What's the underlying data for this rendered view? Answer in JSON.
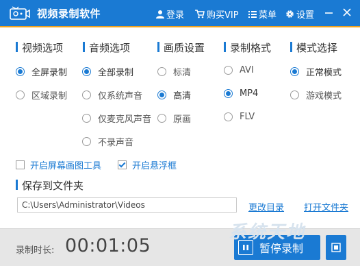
{
  "titlebar": {
    "title": "视频录制软件",
    "login": "登录",
    "vip": "购买VIP",
    "menu": "菜单",
    "settings": "设置"
  },
  "sections": {
    "video": {
      "title": "视频选项",
      "options": [
        "全屏录制",
        "区域录制"
      ],
      "selected": "全屏录制"
    },
    "audio": {
      "title": "音频选项",
      "options": [
        "全部录制",
        "仅系统声音",
        "仅麦克风声音",
        "不录声音"
      ],
      "selected": "全部录制"
    },
    "quality": {
      "title": "画质设置",
      "options": [
        "标清",
        "高清",
        "原画"
      ],
      "selected": "高清"
    },
    "format": {
      "title": "录制格式",
      "options": [
        "AVI",
        "MP4",
        "FLV"
      ],
      "selected": "MP4"
    },
    "mode": {
      "title": "模式选择",
      "options": [
        "正常模式",
        "游戏模式"
      ],
      "selected": "正常模式"
    }
  },
  "checkboxes": {
    "screen_tool": {
      "label": "开启屏幕画图工具",
      "checked": false
    },
    "float_window": {
      "label": "开启悬浮框",
      "checked": true
    }
  },
  "save": {
    "title": "保存到文件夹",
    "path": "C:\\Users\\Administrator\\Videos",
    "change_dir": "更改目录",
    "open_folder": "打开文件夹"
  },
  "bottom": {
    "duration_label": "录制时长:",
    "duration_value": "00:01:05",
    "pause_label": "暂停录制"
  },
  "watermark": "系统天地",
  "colors": {
    "accent": "#1a7ad3",
    "titlebar_border": "#f0a21d"
  }
}
